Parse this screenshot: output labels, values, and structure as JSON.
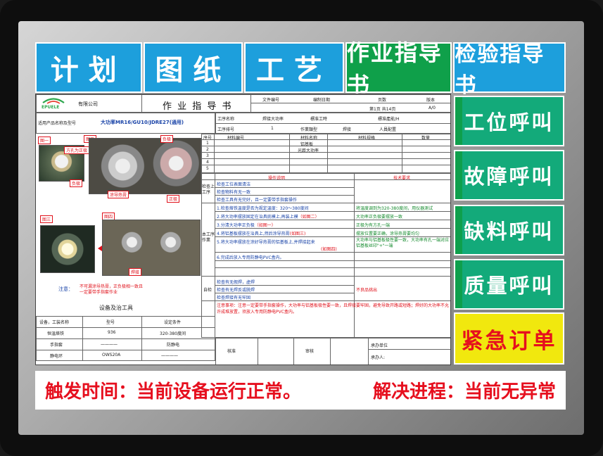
{
  "nav": {
    "plan": "计划",
    "drawing": "图纸",
    "process": "工艺",
    "work_instruction": "作业指导书",
    "inspection_instruction": "检验指导书"
  },
  "side": {
    "station_call": "工位呼叫",
    "fault_call": "故障呼叫",
    "material_call": "缺料呼叫",
    "quality_call": "质量呼叫",
    "urgent_order": "紧急订单"
  },
  "status": {
    "trigger": "触发时间：当前设备运行正常。",
    "progress": "解决进程：当前无异常"
  },
  "doc": {
    "logo": "EPUELE",
    "company": "有限公司",
    "title": "作 业 指 导 书",
    "header": {
      "file_no_label": "文件编号",
      "date_label": "编制日期",
      "pages_label": "页数",
      "version_label": "版本",
      "pages_value": "第1页 共14页",
      "version_value": "A/0"
    },
    "product_label": "适用产品名称及型号",
    "product_value": "大功率MR16/GU10/JDRE27(通用)",
    "work_name_label": "工序名称",
    "work_name_value": "焊接大功率",
    "std_time_label": "標准工時",
    "std_output_label": "標准產能/H",
    "work_seq_label": "工序排号",
    "work_seq_value": "1",
    "work_type_label": "作業類型",
    "work_type_value": "焊接",
    "staff_label": "人員配置",
    "materials": {
      "headers": [
        "序号",
        "材料编号",
        "材料名称",
        "材料规格",
        "数量"
      ],
      "rows": [
        {
          "no": "1",
          "name": "铝基板"
        },
        {
          "no": "2",
          "name": "光距大功率"
        },
        {
          "no": "3",
          "name": ""
        },
        {
          "no": "4",
          "name": ""
        },
        {
          "no": "5",
          "name": ""
        }
      ]
    },
    "images": {
      "fig1": "图一",
      "fig2": "图二",
      "fig3": "图三",
      "fig4": "图四",
      "note_hole": "方孔为正极",
      "note_neg": "负极",
      "note_neg2": "负极",
      "note_pos": "正极",
      "note_paste": "涂导热膏",
      "note_solder": "焊接"
    },
    "notice_label": "注意：",
    "notice_text": "不可漏涂导热膏，正负极相一致且一定要带手指套作业",
    "ops_header": "操作说明",
    "req_header": "技术要求",
    "check_label": "检查上工序",
    "checks": [
      "检查工位表面清洁",
      "检查物料有无一致",
      "检查工具有无完好，且一定要带手指套操作"
    ],
    "work_label": "本工序作業",
    "steps": [
      {
        "text": "1.检查烙铁温度是否为规定温度：320～380度间",
        "req": "将温度调到为320-380度间，用仪器测试"
      },
      {
        "text": "2.将大功率摆放固定在治具底模上,再装上模",
        "note": "（如图二）",
        "req": "大功率正负极要摆放一致"
      },
      {
        "text": "3.分清大功率正负极",
        "note": "（如图一）",
        "req": "正极为有方孔一端"
      },
      {
        "text": "4.将铝基板摆放在治具上,然后涂导热膏",
        "note": "(如图三)",
        "req": "摆放位置要正确，涂导热膏要均匀"
      },
      {
        "text": "5.将大功率摆放在涂好导热膏的铝基板上,并焊接起来",
        "req": "大功率与铝基板极性要一致，大功率有孔一端对应铝基板丝印\"+\"一端"
      },
      {
        "text": "",
        "note": "(如图四)",
        "req": ""
      },
      {
        "text": "6.完成后放入专用防静电PVC盒内。",
        "req": ""
      }
    ],
    "self_check_label": "自检",
    "self_checks": [
      "检查有无假焊，虚焊",
      "检查有无焊反或脱焊",
      "检查焊接有无牢固"
    ],
    "self_check_req": "不良品挑出",
    "caution": "注意事项：注意一定要带手指套操作，大功率与铝基板极性要一致，且焊接要牢固，避免导致开路或短路；焊好的大功率不允许成堆放置，须放入专用防静电PVC盒内。",
    "equip_title": "设备及治工具",
    "equip_headers": [
      "设备，工装名称",
      "型号",
      "设定条件"
    ],
    "equip_rows": [
      {
        "name": "恒温烙铁",
        "model": "936",
        "cond": "320-380度间"
      },
      {
        "name": "手指套",
        "model": "一一一一",
        "cond": "防静电"
      },
      {
        "name": "静电环",
        "model": "OWS20A",
        "cond": "一一一一"
      }
    ],
    "approve_label": "核准",
    "review_label": "审核",
    "issue_unit_label": "承办单位",
    "issuer_label": "承办人:"
  }
}
